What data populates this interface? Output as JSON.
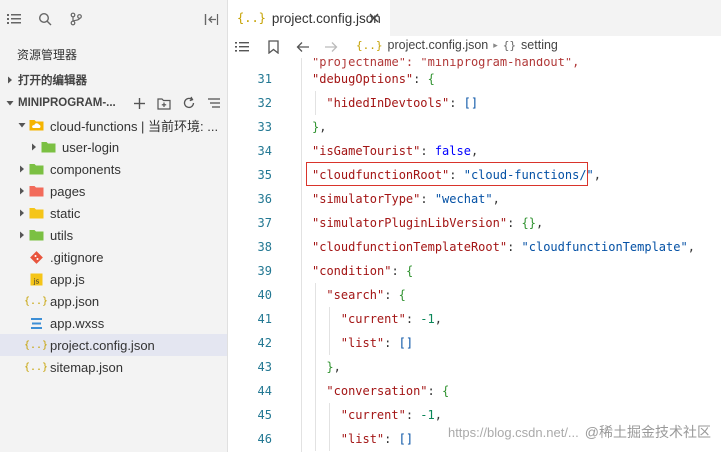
{
  "sidebar": {
    "explorer_title": "资源管理器",
    "open_editors": "打开的编辑器",
    "project_section": "MINIPROGRAM-...",
    "items": [
      {
        "label": "cloud-functions | 当前环境: ...",
        "icon": "cloud-folder-icon",
        "expanded": true,
        "level": 0,
        "color": "#f5b400"
      },
      {
        "label": "user-login",
        "icon": "folder-icon",
        "expanded": false,
        "level": 1,
        "color": "#7bc043"
      },
      {
        "label": "components",
        "icon": "folder-icon",
        "expanded": false,
        "level": 0,
        "color": "#7bc043"
      },
      {
        "label": "pages",
        "icon": "folder-icon",
        "expanded": false,
        "level": 0,
        "color": "#f26b5b"
      },
      {
        "label": "static",
        "icon": "folder-icon",
        "expanded": false,
        "level": 0,
        "color": "#f5c518"
      },
      {
        "label": "utils",
        "icon": "folder-icon",
        "expanded": false,
        "level": 0,
        "color": "#7bc043"
      },
      {
        "label": ".gitignore",
        "icon": "git-icon",
        "level": 0,
        "color": "#e8553e"
      },
      {
        "label": "app.js",
        "icon": "js-file-icon",
        "level": 0,
        "color": "#f5c518"
      },
      {
        "label": "app.json",
        "icon": "json-file-icon",
        "level": 0,
        "color": "#c5a100"
      },
      {
        "label": "app.wxss",
        "icon": "css-file-icon",
        "level": 0,
        "color": "#3d8fd6"
      },
      {
        "label": "project.config.json",
        "icon": "json-file-icon",
        "level": 0,
        "color": "#c5a100",
        "selected": true
      },
      {
        "label": "sitemap.json",
        "icon": "json-file-icon",
        "level": 0,
        "color": "#c5a100"
      }
    ]
  },
  "editor": {
    "tab_label": "project.config.json",
    "tab_icon": "{..}",
    "breadcrumb_file": "project.config.json",
    "breadcrumb_symbol": "setting",
    "partial_top_line": "\"projectname\": \"miniprogram-handout\",",
    "lines": [
      {
        "num": "31",
        "indent": 0,
        "tokens": [
          [
            "k",
            "\"debugOptions\""
          ],
          [
            "p",
            ": "
          ],
          [
            "b",
            "{"
          ]
        ]
      },
      {
        "num": "32",
        "indent": 1,
        "tokens": [
          [
            "k",
            "\"hidedInDevtools\""
          ],
          [
            "p",
            ": "
          ],
          [
            "s",
            "[]"
          ]
        ]
      },
      {
        "num": "33",
        "indent": 0,
        "tokens": [
          [
            "b",
            "}"
          ],
          [
            "p",
            ","
          ]
        ]
      },
      {
        "num": "34",
        "indent": 0,
        "tokens": [
          [
            "k",
            "\"isGameTourist\""
          ],
          [
            "p",
            ": "
          ],
          [
            "w",
            "false"
          ],
          [
            "p",
            ","
          ]
        ]
      },
      {
        "num": "35",
        "indent": 0,
        "tokens": [
          [
            "k",
            "\"cloudfunctionRoot\""
          ],
          [
            "p",
            ": "
          ],
          [
            "s",
            "\"cloud-functions/\""
          ],
          [
            "p",
            ","
          ]
        ]
      },
      {
        "num": "36",
        "indent": 0,
        "tokens": [
          [
            "k",
            "\"simulatorType\""
          ],
          [
            "p",
            ": "
          ],
          [
            "s",
            "\"wechat\""
          ],
          [
            "p",
            ","
          ]
        ]
      },
      {
        "num": "37",
        "indent": 0,
        "tokens": [
          [
            "k",
            "\"simulatorPluginLibVersion\""
          ],
          [
            "p",
            ": "
          ],
          [
            "b",
            "{}"
          ],
          [
            "p",
            ","
          ]
        ]
      },
      {
        "num": "38",
        "indent": 0,
        "tokens": [
          [
            "k",
            "\"cloudfunctionTemplateRoot\""
          ],
          [
            "p",
            ": "
          ],
          [
            "s",
            "\"cloudfunctionTemplate\""
          ],
          [
            "p",
            ","
          ]
        ]
      },
      {
        "num": "39",
        "indent": 0,
        "tokens": [
          [
            "k",
            "\"condition\""
          ],
          [
            "p",
            ": "
          ],
          [
            "b",
            "{"
          ]
        ]
      },
      {
        "num": "40",
        "indent": 1,
        "tokens": [
          [
            "k",
            "\"search\""
          ],
          [
            "p",
            ": "
          ],
          [
            "b",
            "{"
          ]
        ]
      },
      {
        "num": "41",
        "indent": 2,
        "tokens": [
          [
            "k",
            "\"current\""
          ],
          [
            "p",
            ": "
          ],
          [
            "n",
            "-1"
          ],
          [
            "p",
            ","
          ]
        ]
      },
      {
        "num": "42",
        "indent": 2,
        "tokens": [
          [
            "k",
            "\"list\""
          ],
          [
            "p",
            ": "
          ],
          [
            "s",
            "[]"
          ]
        ]
      },
      {
        "num": "43",
        "indent": 1,
        "tokens": [
          [
            "b",
            "}"
          ],
          [
            "p",
            ","
          ]
        ]
      },
      {
        "num": "44",
        "indent": 1,
        "tokens": [
          [
            "k",
            "\"conversation\""
          ],
          [
            "p",
            ": "
          ],
          [
            "b",
            "{"
          ]
        ]
      },
      {
        "num": "45",
        "indent": 2,
        "tokens": [
          [
            "k",
            "\"current\""
          ],
          [
            "p",
            ": "
          ],
          [
            "n",
            "-1"
          ],
          [
            "p",
            ","
          ]
        ]
      },
      {
        "num": "46",
        "indent": 2,
        "tokens": [
          [
            "k",
            "\"list\""
          ],
          [
            "p",
            ": "
          ],
          [
            "s",
            "[]"
          ]
        ]
      }
    ]
  },
  "watermark": {
    "url": "https://blog.csdn.net/...",
    "brand": "@稀土掘金技术社区"
  },
  "colors": {
    "highlight": "#d9342b",
    "selected_row": "#e4e6f1",
    "line_number": "#237893"
  }
}
